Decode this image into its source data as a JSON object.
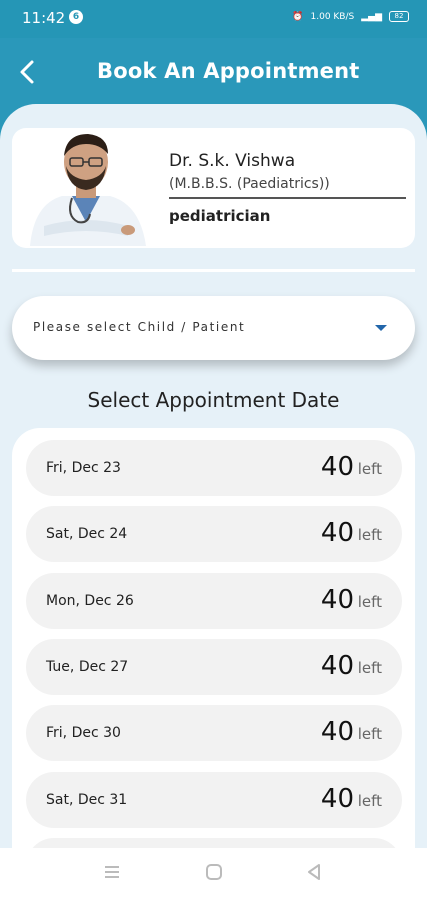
{
  "status": {
    "time": "11:42",
    "badge": "6",
    "net_speed": "1.00 KB/S",
    "battery": "82"
  },
  "header": {
    "title": "Book An Appointment"
  },
  "doctor": {
    "name": "Dr. S.k. Vishwa",
    "qualification": "(M.B.B.S. (Paediatrics))",
    "specialty": "pediatrician"
  },
  "patient_select": {
    "placeholder": "Please select Child / Patient"
  },
  "dates_section": {
    "title": "Select Appointment Date",
    "left_label": "left",
    "dates": [
      {
        "label": "Fri, Dec 23",
        "count": "40"
      },
      {
        "label": "Sat, Dec 24",
        "count": "40"
      },
      {
        "label": "Mon, Dec 26",
        "count": "40"
      },
      {
        "label": "Tue, Dec 27",
        "count": "40"
      },
      {
        "label": "Fri, Dec 30",
        "count": "40"
      },
      {
        "label": "Sat, Dec 31",
        "count": "40"
      }
    ]
  },
  "colors": {
    "header": "#2a98ba",
    "background": "#e6f1f8",
    "dropdown_arrow": "#2266aa"
  }
}
